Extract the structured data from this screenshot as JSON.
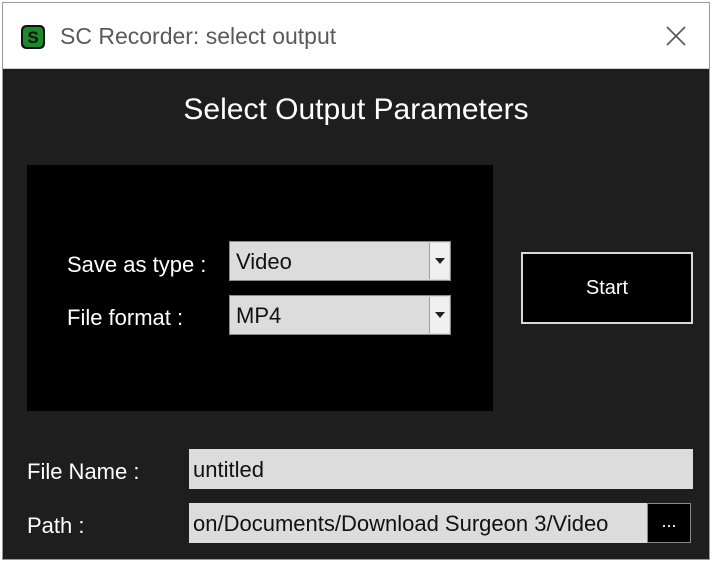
{
  "window": {
    "title": "SC Recorder: select output",
    "app_icon": "sc-recorder-logo-icon",
    "close_icon": "close-icon"
  },
  "heading": "Select Output Parameters",
  "options": {
    "save_as_type_label": "Save as type :",
    "save_as_type_value": "Video",
    "file_format_label": "File format :",
    "file_format_value": "MP4"
  },
  "start_label": "Start",
  "file_name": {
    "label": "File Name :",
    "value": "untitled"
  },
  "path": {
    "label": "Path :",
    "value": "on/Documents/Download Surgeon 3/Video",
    "browse_label": "..."
  },
  "colors": {
    "window_background": "#1e1e1e",
    "panel_background": "#000000",
    "field_background": "#dcdcdc",
    "logo_green": "#1a8a2a"
  }
}
